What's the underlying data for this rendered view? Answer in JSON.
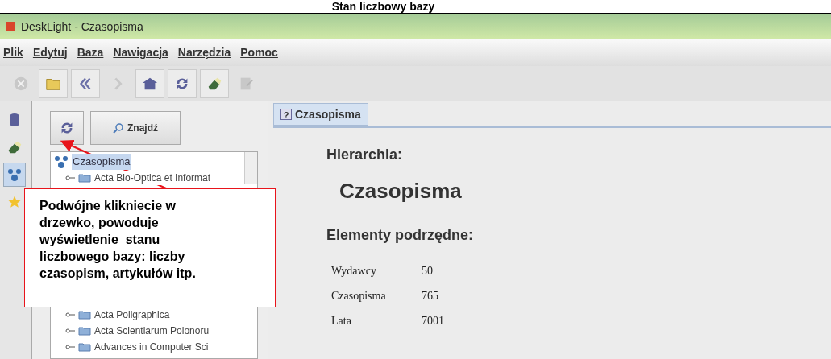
{
  "page_title": "Stan liczbowy bazy",
  "window": {
    "title": "DeskLight - Czasopisma"
  },
  "menu": [
    {
      "label": "Plik"
    },
    {
      "label": "Edytuj"
    },
    {
      "label": "Baza"
    },
    {
      "label": "Nawigacja"
    },
    {
      "label": "Narzędzia"
    },
    {
      "label": "Pomoc"
    }
  ],
  "toolbar": [
    {
      "kind": "stop",
      "disabled": true
    },
    {
      "kind": "open",
      "disabled": false
    },
    {
      "kind": "back",
      "disabled": false
    },
    {
      "kind": "forward",
      "disabled": true
    },
    {
      "kind": "home",
      "disabled": false
    },
    {
      "kind": "refresh",
      "disabled": false
    },
    {
      "kind": "eraser",
      "disabled": false
    },
    {
      "kind": "edit",
      "disabled": true
    }
  ],
  "side_strip": [
    {
      "kind": "database",
      "selected": false
    },
    {
      "kind": "eraser",
      "selected": false
    },
    {
      "kind": "tree",
      "selected": true
    },
    {
      "kind": "star",
      "selected": false
    }
  ],
  "tree_panel": {
    "find_button": "Znajdź",
    "tree": {
      "label": "Czasopisma",
      "selected": true,
      "children": [
        {
          "label": "Acta Bio-Optica et Informat"
        },
        {
          "label": "Acta Poligraphica"
        },
        {
          "label": "Acta Scientiarum Polonoru"
        },
        {
          "label": "Advances in Computer Sci"
        }
      ]
    }
  },
  "callout": {
    "text": "Podwójne klikniecie w drzewko, powoduje wyświetlenie  stanu liczbowego bazy: liczby czasopism, artykułów itp."
  },
  "content": {
    "tab": {
      "label": "Czasopisma",
      "icon": "?",
      "selected": true
    },
    "hierarchy_label": "Hierarchia:",
    "hierarchy_value": "Czasopisma",
    "children_label": "Elementy podrzędne:",
    "rows": [
      {
        "name": "Wydawcy",
        "value": "50"
      },
      {
        "name": "Czasopisma",
        "value": "765"
      },
      {
        "name": "Lata",
        "value": "7001"
      }
    ]
  }
}
